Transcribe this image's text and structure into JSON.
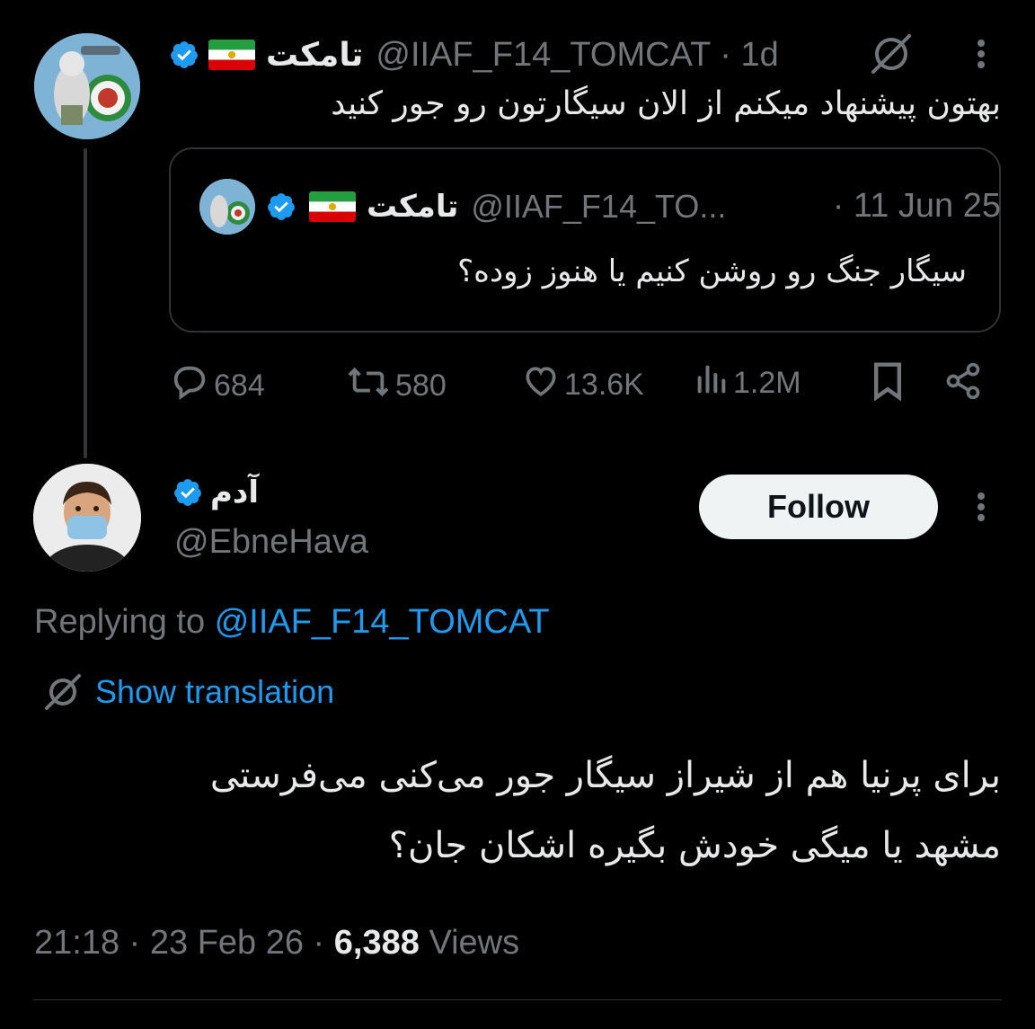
{
  "tweet1": {
    "name": "تامکت",
    "handle": "@IIAF_F14_TOMCAT",
    "time": "· 1d",
    "text": "بهتون پیشنهاد میکنم از الان سیگارتون رو جور کنید"
  },
  "quote": {
    "name": "تامکت",
    "handle": "@IIAF_F14_TO...",
    "time": "· 11 Jun 25",
    "text": "سیگار جنگ رو روشن کنیم یا هنوز زوده؟"
  },
  "actions": {
    "replies": "684",
    "retweets": "580",
    "likes": "13.6K",
    "views": "1.2M"
  },
  "tweet2": {
    "name": "آدم",
    "handle": "@EbneHava",
    "follow_label": "Follow",
    "replying_prefix": "Replying to",
    "replying_handle": "@IIAF_F14_TOMCAT",
    "show_translation": "Show translation",
    "text_line1": "برای پرنیا هم از شیراز سیگار جور می‌کنی می‌فرستی",
    "text_line2": "مشهد یا میگی خودش بگیره اشکان جان؟",
    "time": "21:18 · 23 Feb 26 ·",
    "views_count": "6,388",
    "views_label": "Views"
  },
  "colors": {
    "background": "#000000",
    "text": "#e7e9ea",
    "secondary": "#71767b",
    "accent": "#1d9bf0",
    "verified": "#1d9bf0"
  },
  "icons": [
    "verified-icon",
    "iran-lion-sun-flag-icon",
    "grok-icon",
    "more-icon",
    "reply-icon",
    "retweet-icon",
    "like-icon",
    "views-icon",
    "bookmark-icon",
    "share-icon",
    "translate-icon"
  ]
}
